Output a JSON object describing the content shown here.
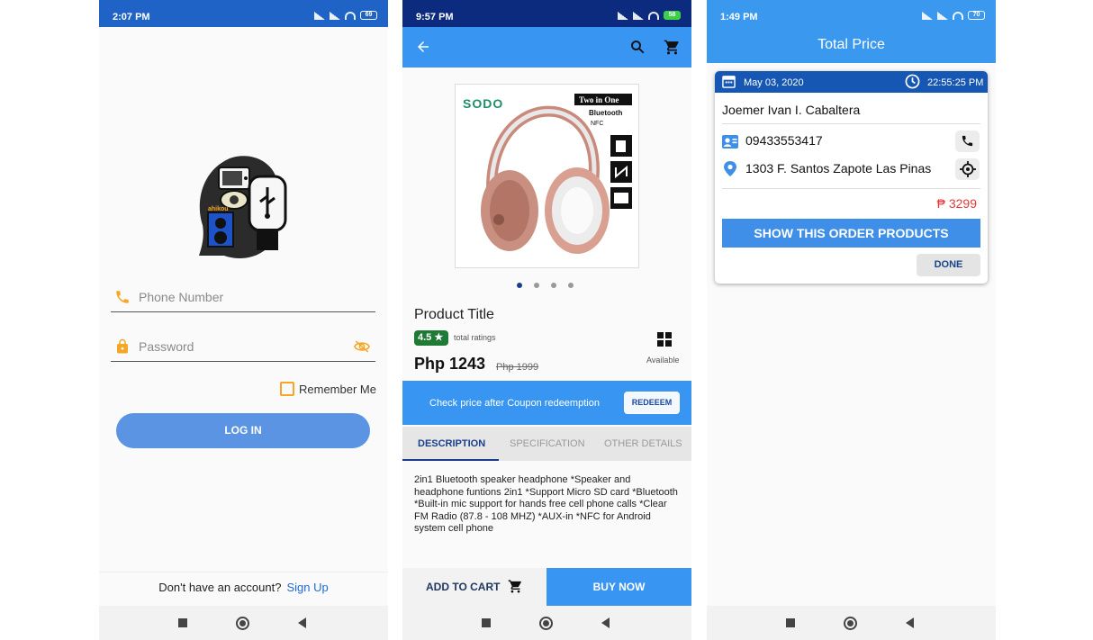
{
  "screen1": {
    "status": {
      "time": "2:07 PM",
      "battery": "69"
    },
    "phone_placeholder": "Phone Number",
    "password_placeholder": "Password",
    "remember_label": "Remember Me",
    "login_label": "LOG IN",
    "signup_prompt": "Don't have an account?",
    "signup_link": "Sign Up",
    "logo_text": "ahikou",
    "colors": {
      "status_bar": "#1f63c7",
      "login_button": "#5b94e3",
      "link": "#1e6bd6",
      "field_icon": "#f5a623"
    }
  },
  "screen2": {
    "status": {
      "time": "9:57 PM",
      "battery": "58"
    },
    "product": {
      "brand": "SODO",
      "badge_text": "Two in One",
      "badge_bt": "Bluetooth",
      "badge_nfc": "NFC",
      "carousel_pages": 4,
      "carousel_active": 1,
      "title": "Product Title",
      "rating": "4.5 ★",
      "rating_label": "total ratings",
      "availability": "Available",
      "price": "Php 1243",
      "old_price": "Php 1999"
    },
    "coupon": {
      "text": "Check price after Coupon redeemption",
      "button": "REDEEEM"
    },
    "tabs": [
      {
        "label": "DESCRIPTION",
        "active": true
      },
      {
        "label": "SPECIFICATION",
        "active": false
      },
      {
        "label": "OTHER DETAILS",
        "active": false
      }
    ],
    "description": "2in1 Bluetooth speaker headphone *Speaker and headphone funtions 2in1 *Support Micro SD card *Bluetooth *Built-in mic support for hands free cell phone calls *Clear FM Radio (87.8 - 108 MHZ) *AUX-in *NFC for Android system cell phone",
    "actions": {
      "add_to_cart": "ADD TO CART",
      "buy_now": "BUY NOW"
    },
    "colors": {
      "status_bar": "#0d2b7e",
      "app_bar": "#3895f2",
      "rating_badge": "#1e7a34",
      "tab_active": "#1b3e8a"
    }
  },
  "screen3": {
    "status": {
      "time": "1:49 PM",
      "battery": "70"
    },
    "title": "Total Price",
    "order": {
      "date": "May 03, 2020",
      "time": "22:55:25 PM",
      "customer": "Joemer Ivan I. Cabaltera",
      "phone": "09433553417",
      "address": "1303 F. Santos Zapote Las Pinas",
      "total": "₱ 3299"
    },
    "show_button": "SHOW THIS ORDER PRODUCTS",
    "done_button": "DONE",
    "colors": {
      "app_bar": "#3b98ef",
      "card_header": "#1657b3",
      "total": "#e53935",
      "show_button": "#3f8fe8"
    }
  }
}
